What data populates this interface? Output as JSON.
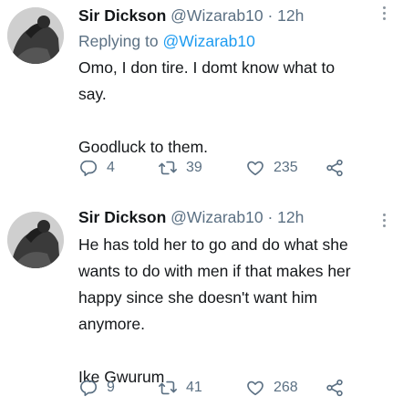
{
  "tweets": [
    {
      "author_name": "Sir Dickson",
      "handle": "@Wizarab10",
      "separator": "·",
      "time": "12h",
      "replying_prefix": "Replying to",
      "replying_to": "@Wizarab10",
      "body_lines": [
        "Omo, I don tire. I domt know what to",
        "say.",
        "",
        "Goodluck to them."
      ],
      "replies": "4",
      "retweets": "39",
      "likes": "235"
    },
    {
      "author_name": "Sir Dickson",
      "handle": "@Wizarab10",
      "separator": "·",
      "time": "12h",
      "body_lines": [
        "He has told her to go and do what she",
        "wants to do with men if that makes her",
        "happy since she doesn't want him",
        "anymore.",
        "",
        "Ike Gwurum"
      ],
      "replies": "9",
      "retweets": "41",
      "likes": "268"
    }
  ],
  "icons": {
    "reply": "reply-icon",
    "retweet": "retweet-icon",
    "like": "heart-icon",
    "share": "share-icon",
    "more": "more-dots-icon"
  },
  "colors": {
    "text": "#14171a",
    "secondary": "#5b7083",
    "link": "#1d9bf0",
    "background": "#ffffff"
  }
}
